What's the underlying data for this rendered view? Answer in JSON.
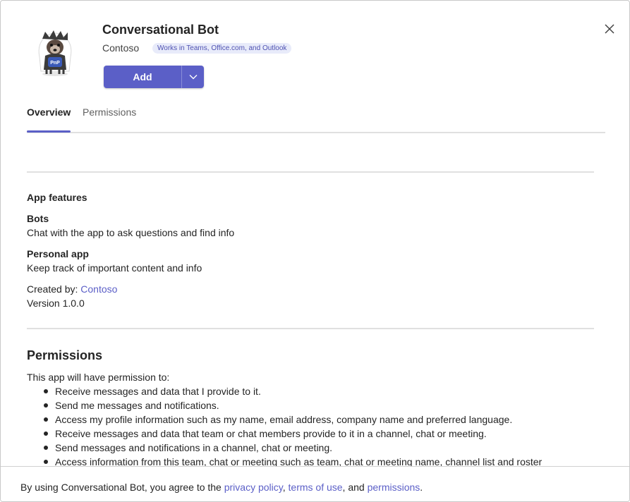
{
  "app": {
    "name": "Conversational Bot",
    "publisher": "Contoso",
    "badge": "Works in Teams, Office.com, and Outlook",
    "add_label": "Add",
    "logo_text": "PnP"
  },
  "tabs": [
    {
      "label": "Overview",
      "selected": true
    },
    {
      "label": "Permissions",
      "selected": false
    }
  ],
  "features": {
    "heading": "App features",
    "items": [
      {
        "title": "Bots",
        "description": "Chat with the app to ask questions and find info"
      },
      {
        "title": "Personal app",
        "description": "Keep track of important content and info"
      }
    ],
    "created_by_label": "Created by: ",
    "created_by": "Contoso",
    "version": "Version 1.0.0"
  },
  "permissions": {
    "heading": "Permissions",
    "intro": "This app will have permission to:",
    "items": [
      "Receive messages and data that I provide to it.",
      "Send me messages and notifications.",
      "Access my profile information such as my name, email address, company name and preferred language.",
      "Receive messages and data that team or chat members provide to it in a channel, chat or meeting.",
      "Send messages and notifications in a channel, chat or meeting.",
      "Access information from this team, chat or meeting such as team, chat or meeting name, channel list and roster"
    ]
  },
  "footer": {
    "prefix": "By using Conversational Bot, you agree to the ",
    "privacy": "privacy policy",
    "sep1": ", ",
    "terms": "terms of use",
    "sep2": ", and ",
    "permissions": "permissions",
    "suffix": "."
  },
  "colors": {
    "accent": "#5b5fc7",
    "badge_bg": "#e8ebfa",
    "text": "#242424"
  }
}
